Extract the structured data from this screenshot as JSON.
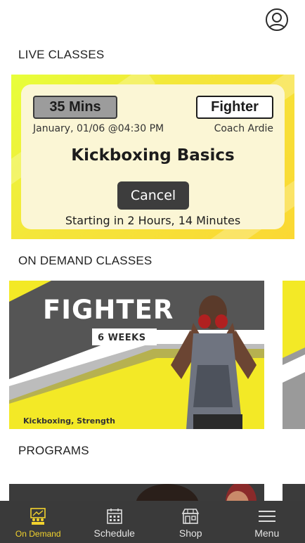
{
  "header": {
    "avatar_icon": "user-icon"
  },
  "sections": {
    "live": "LIVE CLASSES",
    "on_demand": "ON DEMAND CLASSES",
    "programs": "PROGRAMS"
  },
  "live_class": {
    "duration": "35  Mins",
    "type": "Fighter",
    "date": "January, 01/06 @04:30 PM",
    "coach": "Coach Ardie",
    "title": "Kickboxing Basics",
    "cancel_label": "Cancel",
    "starting": "Starting in 2 Hours, 14 Minutes"
  },
  "on_demand": [
    {
      "title": "FIGHTER",
      "weeks": "6 WEEKS",
      "tags": "Kickboxing, Strength"
    }
  ],
  "nav": [
    {
      "label": "On Demand",
      "icon": "classroom-icon",
      "active": true
    },
    {
      "label": "Schedule",
      "icon": "calendar-icon",
      "active": false
    },
    {
      "label": "Shop",
      "icon": "store-icon",
      "active": false
    },
    {
      "label": "Menu",
      "icon": "hamburger-menu-icon",
      "active": false
    }
  ],
  "colors": {
    "accent_yellow": "#f3e926",
    "active_nav": "#f2d22e",
    "nav_bg": "#3a3a3a",
    "card_cream": "#fbf6d5"
  }
}
